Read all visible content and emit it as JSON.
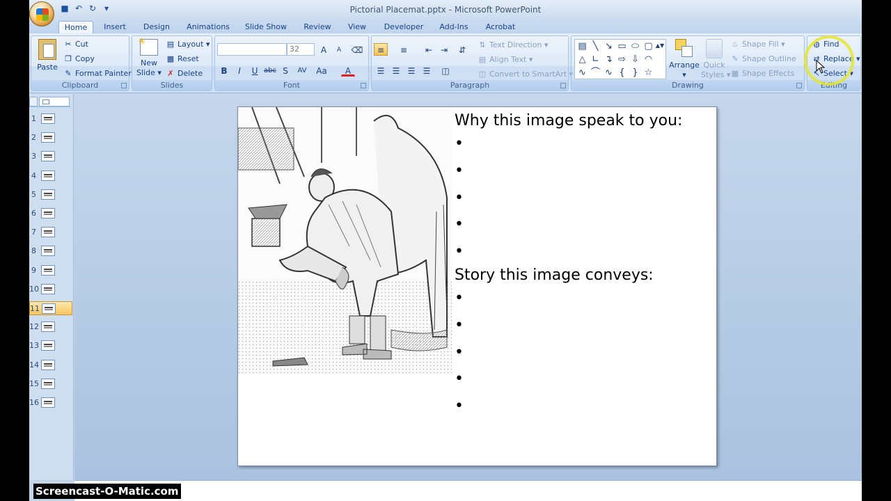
{
  "window": {
    "title": "Pictorial Placemat.pptx - Microsoft PowerPoint"
  },
  "tabs": [
    "Home",
    "Insert",
    "Design",
    "Animations",
    "Slide Show",
    "Review",
    "View",
    "Developer",
    "Add-Ins",
    "Acrobat"
  ],
  "ribbon": {
    "clipboard": {
      "label": "Clipboard",
      "paste": "Paste",
      "cut": "Cut",
      "copy": "Copy",
      "format_painter": "Format Painter"
    },
    "slides": {
      "label": "Slides",
      "new_slide_1": "New",
      "new_slide_2": "Slide",
      "layout": "Layout",
      "reset": "Reset",
      "delete": "Delete"
    },
    "font": {
      "label": "Font",
      "font_name": "",
      "font_size": "32",
      "bold": "B",
      "italic": "I",
      "underline": "U",
      "strike": "abc",
      "shadow": "S",
      "spacing": "AV",
      "case": "Aa",
      "color": "A",
      "grow": "A",
      "shrink": "A"
    },
    "paragraph": {
      "label": "Paragraph",
      "text_direction": "Text Direction",
      "align_text": "Align Text",
      "convert_smartart": "Convert to SmartArt"
    },
    "drawing": {
      "label": "Drawing",
      "arrange": "Arrange",
      "quick_styles_1": "Quick",
      "quick_styles_2": "Styles",
      "shape_fill": "Shape Fill",
      "shape_outline": "Shape Outline",
      "shape_effects": "Shape Effects"
    },
    "editing": {
      "label": "Editing",
      "find": "Find",
      "replace": "Replace",
      "select": "Select"
    }
  },
  "slides_panel": {
    "numbers": [
      "1",
      "2",
      "3",
      "4",
      "5",
      "6",
      "7",
      "8",
      "9",
      "10",
      "11",
      "12",
      "13",
      "14",
      "15",
      "16"
    ],
    "selected": "11"
  },
  "slide": {
    "heading1": "Why this image speak to you:",
    "heading2": "Story this image conveys:",
    "bullet_char": "•"
  },
  "watermark": "Screencast-O-Matic.com",
  "colors": {
    "ribbon": "#dbe7f6",
    "accent": "#15428b",
    "selected": "#f8c660"
  }
}
